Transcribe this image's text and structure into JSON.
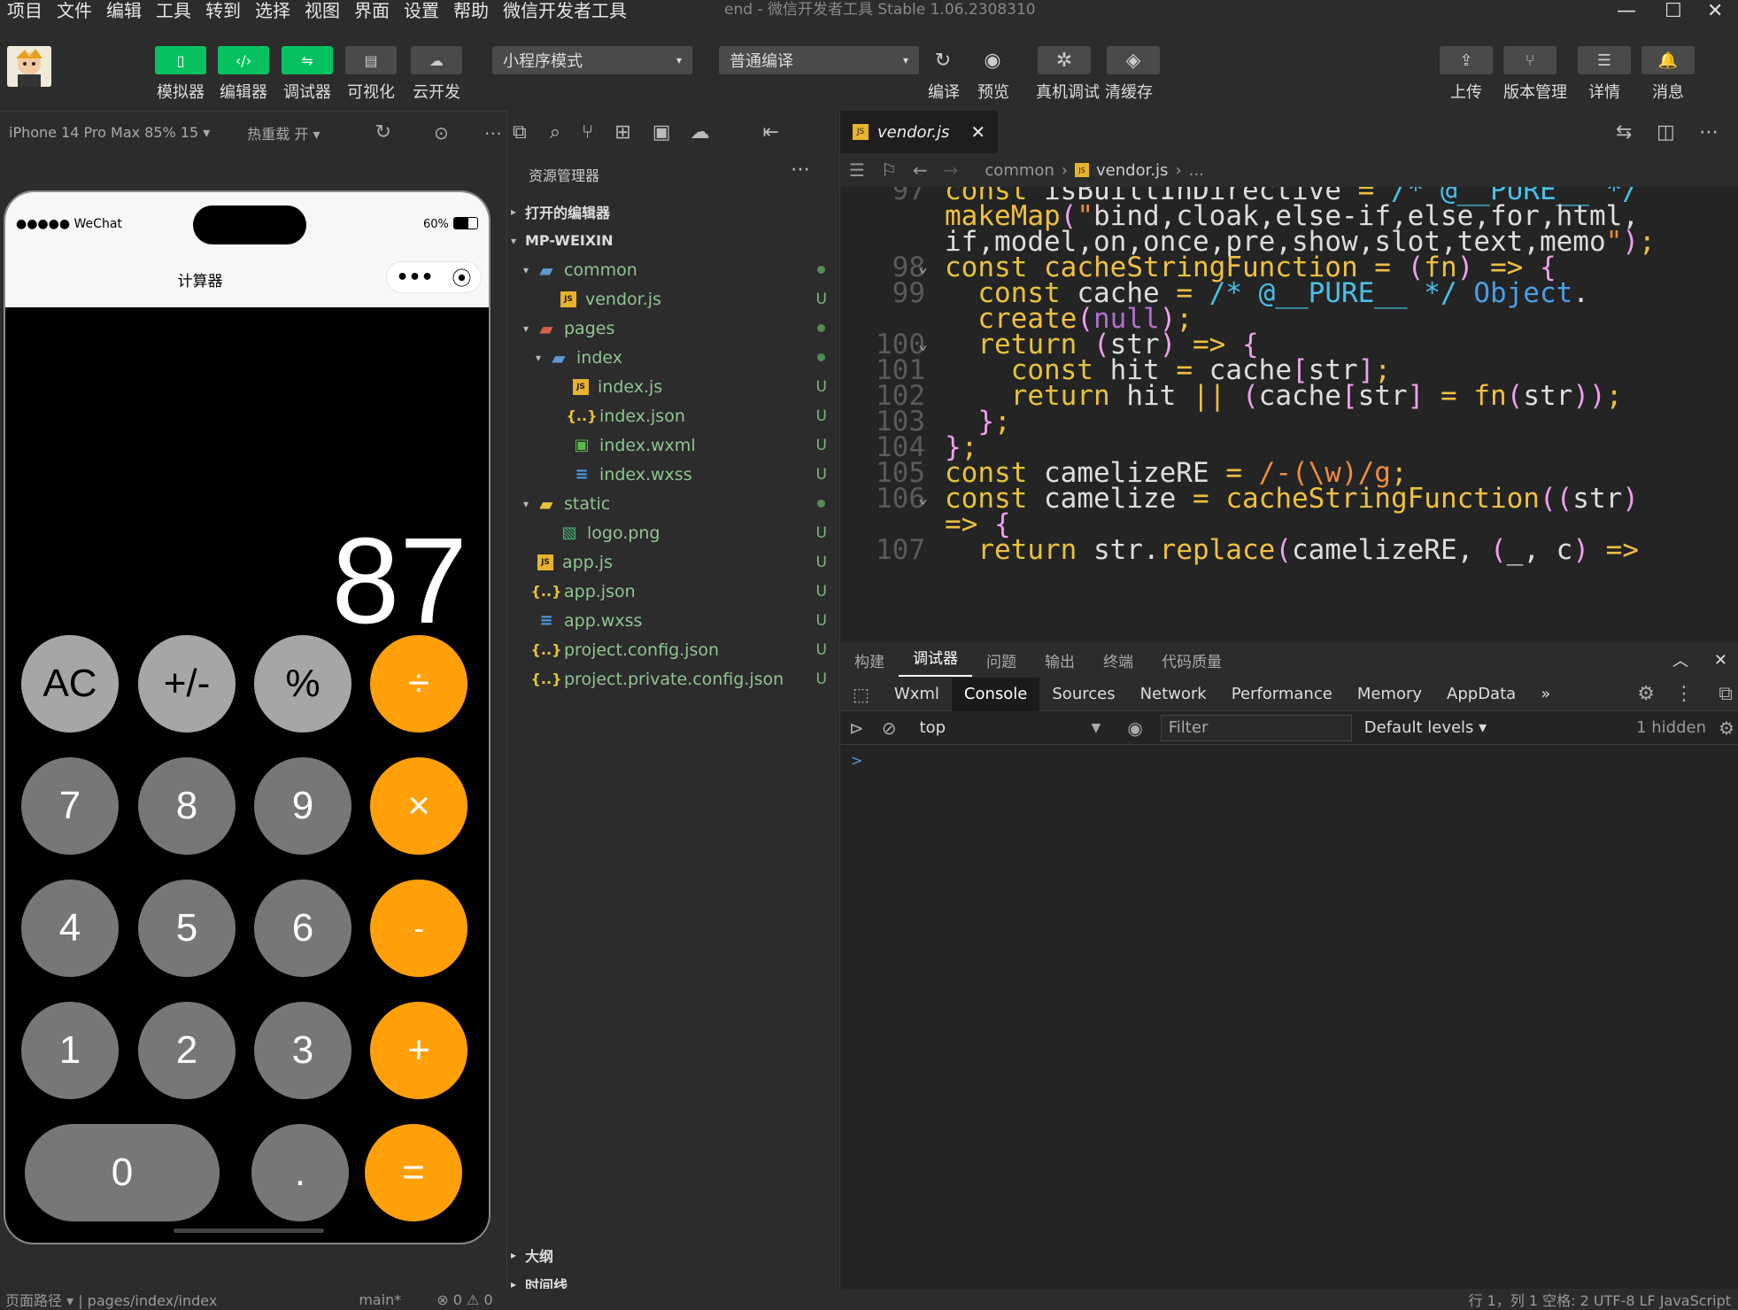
{
  "menu": [
    "项目",
    "文件",
    "编辑",
    "工具",
    "转到",
    "选择",
    "视图",
    "界面",
    "设置",
    "帮助",
    "微信开发者工具"
  ],
  "window_title": "end - 微信开发者工具 Stable 1.06.2308310",
  "toolbar": {
    "left_buttons": [
      {
        "label": "模拟器",
        "icon": "phone-icon"
      },
      {
        "label": "编辑器",
        "icon": "code-icon"
      },
      {
        "label": "调试器",
        "icon": "debug-icon"
      },
      {
        "label": "可视化",
        "icon": "layout-icon"
      },
      {
        "label": "云开发",
        "icon": "cloud-icon"
      }
    ],
    "mode_select": "小程序模式",
    "compile_select": "普通编译",
    "mid_buttons": [
      {
        "label": "编译",
        "icon": "refresh-icon"
      },
      {
        "label": "预览",
        "icon": "eye-icon"
      },
      {
        "label": "真机调试",
        "icon": "bug-icon"
      },
      {
        "label": "清缓存",
        "icon": "layers-icon"
      }
    ],
    "right_buttons": [
      {
        "label": "上传",
        "icon": "upload-icon"
      },
      {
        "label": "版本管理",
        "icon": "branch-icon"
      },
      {
        "label": "详情",
        "icon": "menu-icon"
      },
      {
        "label": "消息",
        "icon": "bell-icon"
      }
    ]
  },
  "simulator": {
    "device": "iPhone 14 Pro Max 85% 15 ▾",
    "hot_reload": "热重载 开 ▾",
    "status_left": "●●●●● WeChat",
    "battery": "60%",
    "page_title": "计算器",
    "display_value": "87",
    "keys": [
      {
        "label": "AC",
        "style": "gray1"
      },
      {
        "label": "+/-",
        "style": "gray1"
      },
      {
        "label": "%",
        "style": "gray1"
      },
      {
        "label": "÷",
        "style": "orange"
      },
      {
        "label": "7",
        "style": "gray2"
      },
      {
        "label": "8",
        "style": "gray2"
      },
      {
        "label": "9",
        "style": "gray2"
      },
      {
        "label": "×",
        "style": "orange"
      },
      {
        "label": "4",
        "style": "gray2"
      },
      {
        "label": "5",
        "style": "gray2"
      },
      {
        "label": "6",
        "style": "gray2"
      },
      {
        "label": "-",
        "style": "orange"
      },
      {
        "label": "1",
        "style": "gray2"
      },
      {
        "label": "2",
        "style": "gray2"
      },
      {
        "label": "3",
        "style": "gray2"
      },
      {
        "label": "+",
        "style": "orange"
      },
      {
        "label": "0",
        "style": "gray2"
      },
      {
        "label": ".",
        "style": "gray2"
      },
      {
        "label": "=",
        "style": "orange"
      }
    ]
  },
  "explorer": {
    "title": "资源管理器",
    "open_editors": "打开的编辑器",
    "root": "MP-WEIXIN",
    "tree": [
      {
        "name": "common",
        "type": "folder",
        "depth": 1,
        "status": "dot",
        "expanded": true
      },
      {
        "name": "vendor.js",
        "type": "js",
        "depth": 2,
        "status": "U"
      },
      {
        "name": "pages",
        "type": "folder",
        "depth": 1,
        "status": "dot",
        "expanded": true
      },
      {
        "name": "index",
        "type": "folder",
        "depth": 2,
        "status": "dot",
        "expanded": true
      },
      {
        "name": "index.js",
        "type": "js",
        "depth": 3,
        "status": "U"
      },
      {
        "name": "index.json",
        "type": "json",
        "depth": 3,
        "status": "U"
      },
      {
        "name": "index.wxml",
        "type": "wxml",
        "depth": 3,
        "status": "U"
      },
      {
        "name": "index.wxss",
        "type": "wxss",
        "depth": 3,
        "status": "U"
      },
      {
        "name": "static",
        "type": "folder",
        "depth": 1,
        "status": "dot",
        "expanded": true
      },
      {
        "name": "logo.png",
        "type": "png",
        "depth": 2,
        "status": "U"
      },
      {
        "name": "app.js",
        "type": "js",
        "depth": 1,
        "status": "U"
      },
      {
        "name": "app.json",
        "type": "json",
        "depth": 1,
        "status": "U"
      },
      {
        "name": "app.wxss",
        "type": "wxss",
        "depth": 1,
        "status": "U"
      },
      {
        "name": "project.config.json",
        "type": "json",
        "depth": 1,
        "status": "U"
      },
      {
        "name": "project.private.config.json",
        "type": "json",
        "depth": 1,
        "status": "U"
      }
    ],
    "outline": "大纲",
    "timeline": "时间线"
  },
  "editor": {
    "tab": "vendor.js",
    "breadcrumb": [
      "common",
      "vendor.js",
      "..."
    ],
    "lines": [
      {
        "num": "97",
        "text": "const isBuiltInDirective = /* @__PURE__ */"
      },
      {
        "num": "",
        "text": "makeMap(\"bind,cloak,else-if,else,for,html,"
      },
      {
        "num": "",
        "text": "if,model,on,once,pre,show,slot,text,memo\");"
      },
      {
        "num": "98",
        "text": "const cacheStringFunction = (fn) => {",
        "fold": true
      },
      {
        "num": "99",
        "text": "  const cache = /* @__PURE__ */ Object."
      },
      {
        "num": "",
        "text": "  create(null);"
      },
      {
        "num": "100",
        "text": "  return (str) => {",
        "fold": true
      },
      {
        "num": "101",
        "text": "    const hit = cache[str];"
      },
      {
        "num": "102",
        "text": "    return hit || (cache[str] = fn(str));"
      },
      {
        "num": "103",
        "text": "  };"
      },
      {
        "num": "104",
        "text": "};"
      },
      {
        "num": "105",
        "text": "const camelizeRE = /-(\\w)/g;"
      },
      {
        "num": "106",
        "text": "const camelize = cacheStringFunction((str)",
        "fold": true
      },
      {
        "num": "",
        "text": "=> {"
      },
      {
        "num": "107",
        "text": "  return str.replace(camelizeRE, (_, c) =>"
      }
    ]
  },
  "devtools": {
    "panel_tabs": [
      "构建",
      "调试器",
      "问题",
      "输出",
      "终端",
      "代码质量"
    ],
    "active_panel": "调试器",
    "tabs": [
      "Wxml",
      "Console",
      "Sources",
      "Network",
      "Performance",
      "Memory",
      "AppData",
      "»"
    ],
    "active_tab": "Console",
    "context": "top",
    "filter_placeholder": "Filter",
    "levels": "Default levels ▾",
    "hidden": "1 hidden",
    "prompt": ">"
  },
  "statusbar": {
    "left": "页面路径 ▾  |  pages/index/index",
    "branch": "main*",
    "problems": "⊗ 0 ⚠ 0",
    "right": "行 1，列 1   空格: 2   UTF-8   LF   JavaScript"
  }
}
